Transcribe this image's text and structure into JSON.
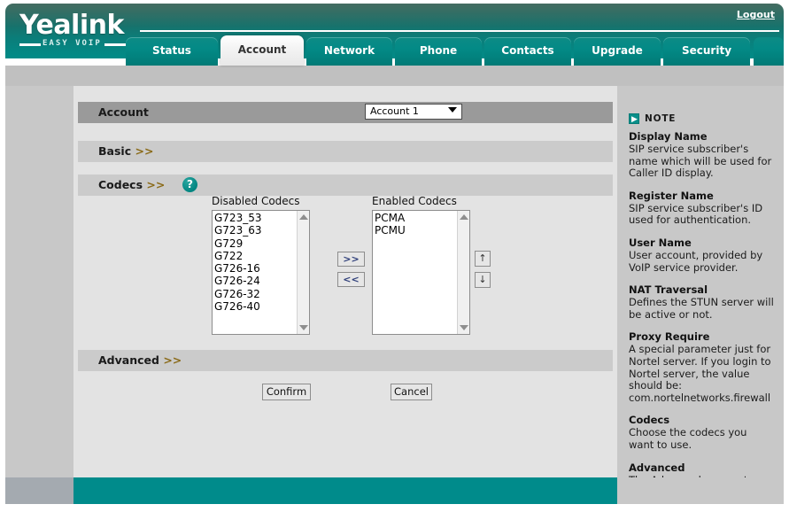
{
  "header": {
    "logo_word": "Yealink",
    "logo_tagline": "EASY VOIP",
    "logout_label": "Logout"
  },
  "tabs": [
    {
      "label": "Status",
      "active": false
    },
    {
      "label": "Account",
      "active": true
    },
    {
      "label": "Network",
      "active": false
    },
    {
      "label": "Phone",
      "active": false
    },
    {
      "label": "Contacts",
      "active": false
    },
    {
      "label": "Upgrade",
      "active": false
    },
    {
      "label": "Security",
      "active": false
    }
  ],
  "sections": {
    "account_label": "Account",
    "basic_label": "Basic",
    "codecs_label": "Codecs",
    "advanced_label": "Advanced",
    "chevron": ">>",
    "help_glyph": "?"
  },
  "account_select": {
    "value": "Account 1",
    "options": [
      "Account 1"
    ]
  },
  "codecs": {
    "disabled_title": "Disabled Codecs",
    "enabled_title": "Enabled Codecs",
    "disabled": [
      "G723_53",
      "G723_63",
      "G729",
      "G722",
      "G726-16",
      "G726-24",
      "G726-32",
      "G726-40"
    ],
    "enabled": [
      "PCMA",
      "PCMU"
    ],
    "add_label": ">>",
    "remove_label": "<<",
    "move_up_label": "↑",
    "move_down_label": "↓"
  },
  "actions": {
    "confirm_label": "Confirm",
    "cancel_label": "Cancel"
  },
  "note": {
    "heading": "NOTE",
    "arrow_glyph": "➡",
    "items": [
      {
        "title": "Display Name",
        "body": "SIP service subscriber's name which will be used for Caller ID display."
      },
      {
        "title": "Register Name",
        "body": "SIP service subscriber's ID used for authentication."
      },
      {
        "title": "User Name",
        "body": "User account, provided by VoIP service provider."
      },
      {
        "title": "NAT Traversal",
        "body": "Defines the STUN server will be active or not."
      },
      {
        "title": "Proxy Require",
        "body": "A special parameter just for Nortel server. If you login to Nortel server, the value should be: com.nortelnetworks.firewall"
      },
      {
        "title": "Codecs",
        "body": "Choose the codecs you want to use."
      },
      {
        "title": "Advanced",
        "body": "The Advanced parameters for administrator."
      }
    ]
  },
  "colors": {
    "brand_teal": "#008b8b",
    "header_green": "#2f5c4f",
    "panel_bg": "#e3e3e3",
    "rail_gray": "#c8c8c8",
    "section_gray": "#cbcbcb",
    "account_row_gray": "#9a9a9a"
  }
}
